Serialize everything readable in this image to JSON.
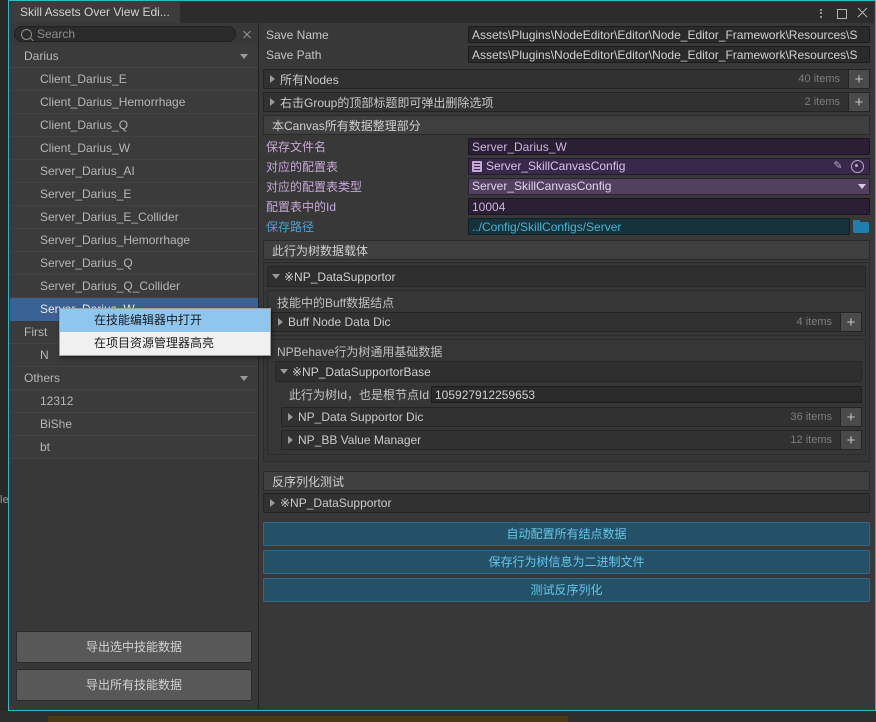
{
  "window": {
    "tab_title": "Skill Assets Over View Edi...",
    "controls": {
      "menu": "kebab-menu",
      "maximize": "maximize",
      "close": "close"
    }
  },
  "sidebar": {
    "search": {
      "placeholder": "Search",
      "value": "",
      "clear_label": "×"
    },
    "groups": [
      {
        "label": "Darius",
        "expanded": true,
        "items": [
          "Client_Darius_E",
          "Client_Darius_Hemorrhage",
          "Client_Darius_Q",
          "Client_Darius_W",
          "Server_Darius_AI",
          "Server_Darius_E",
          "Server_Darius_E_Collider",
          "Server_Darius_Hemorrhage",
          "Server_Darius_Q",
          "Server_Darius_Q_Collider",
          "Server_Darius_W"
        ],
        "selected": "Server_Darius_W"
      },
      {
        "label": "First",
        "expanded": true,
        "items": [
          "N"
        ]
      },
      {
        "label": "Others",
        "expanded": true,
        "items": [
          "12312",
          "BiShe",
          "bt"
        ]
      }
    ],
    "buttons": [
      "导出选中技能数据",
      "导出所有技能数据"
    ]
  },
  "context_menu": {
    "items": [
      {
        "label": "在技能编辑器中打开",
        "highlighted": true
      },
      {
        "label": "在项目资源管理器高亮",
        "highlighted": false
      }
    ]
  },
  "inspector": {
    "save_name": {
      "label": "Save Name",
      "value": "Assets\\Plugins\\NodeEditor\\Editor\\Node_Editor_Framework\\Resources\\S"
    },
    "save_path": {
      "label": "Save Path",
      "value": "Assets\\Plugins\\NodeEditor\\Editor\\Node_Editor_Framework\\Resources\\S"
    },
    "all_nodes": {
      "label": "所有Nodes",
      "count": "40 items",
      "add": "+"
    },
    "groups_row": {
      "label": "右击Group的顶部标题即可弹出删除选项",
      "count": "2 items",
      "add": "+"
    },
    "canvas_section": {
      "title": "本Canvas所有数据整理部分"
    },
    "fields": [
      {
        "name": "save-file-name",
        "label": "保存文件名",
        "value": "Server_Darius_W",
        "style": "purple"
      },
      {
        "name": "config-table",
        "label": "对应的配置表",
        "value": "Server_SkillCanvasConfig",
        "style": "purple-obj"
      },
      {
        "name": "config-table-type",
        "label": "对应的配置表类型",
        "value": "Server_SkillCanvasConfig",
        "style": "purple-pop"
      },
      {
        "name": "config-id",
        "label": "配置表中的Id",
        "value": "10004",
        "style": "purple"
      },
      {
        "name": "save-path-field",
        "label": "保存路径",
        "value": "../Config/SkillConfigs/Server",
        "style": "teal"
      }
    ],
    "tree_section": {
      "title": "此行为树数据载体"
    },
    "data_supportor": {
      "label": "※NP_DataSupportor"
    },
    "buff_section": {
      "title": "技能中的Buff数据结点"
    },
    "buff_node_dic": {
      "label": "Buff Node Data Dic",
      "count": "4 items",
      "add": "+"
    },
    "npbehave_section": {
      "title": "NPBehave行为树通用基础数据"
    },
    "data_supportor_base": {
      "label": "※NP_DataSupportorBase"
    },
    "tree_id": {
      "label": "此行为树Id，也是根节点Id",
      "value": "105927912259653"
    },
    "data_supportor_dic": {
      "label": "NP_Data Supportor Dic",
      "count": "36 items",
      "add": "+"
    },
    "bb_value_manager": {
      "label": "NP_BB Value Manager",
      "count": "12 items",
      "add": "+"
    },
    "deserialize_section": {
      "title": "反序列化测试"
    },
    "deserialize_obj": {
      "label": "※NP_DataSupportor"
    },
    "action_buttons": [
      "自动配置所有结点数据",
      "保存行为树信息为二进制文件",
      "测试反序列化"
    ]
  },
  "colors": {
    "accent_border": "#2eb8c8",
    "selection_blue": "#3a6294",
    "menu_highlight": "#8ec6f0",
    "teal_text": "#49b3d4",
    "purple_field": "#2a1f33"
  },
  "ghost": {
    "fragment": "le"
  }
}
